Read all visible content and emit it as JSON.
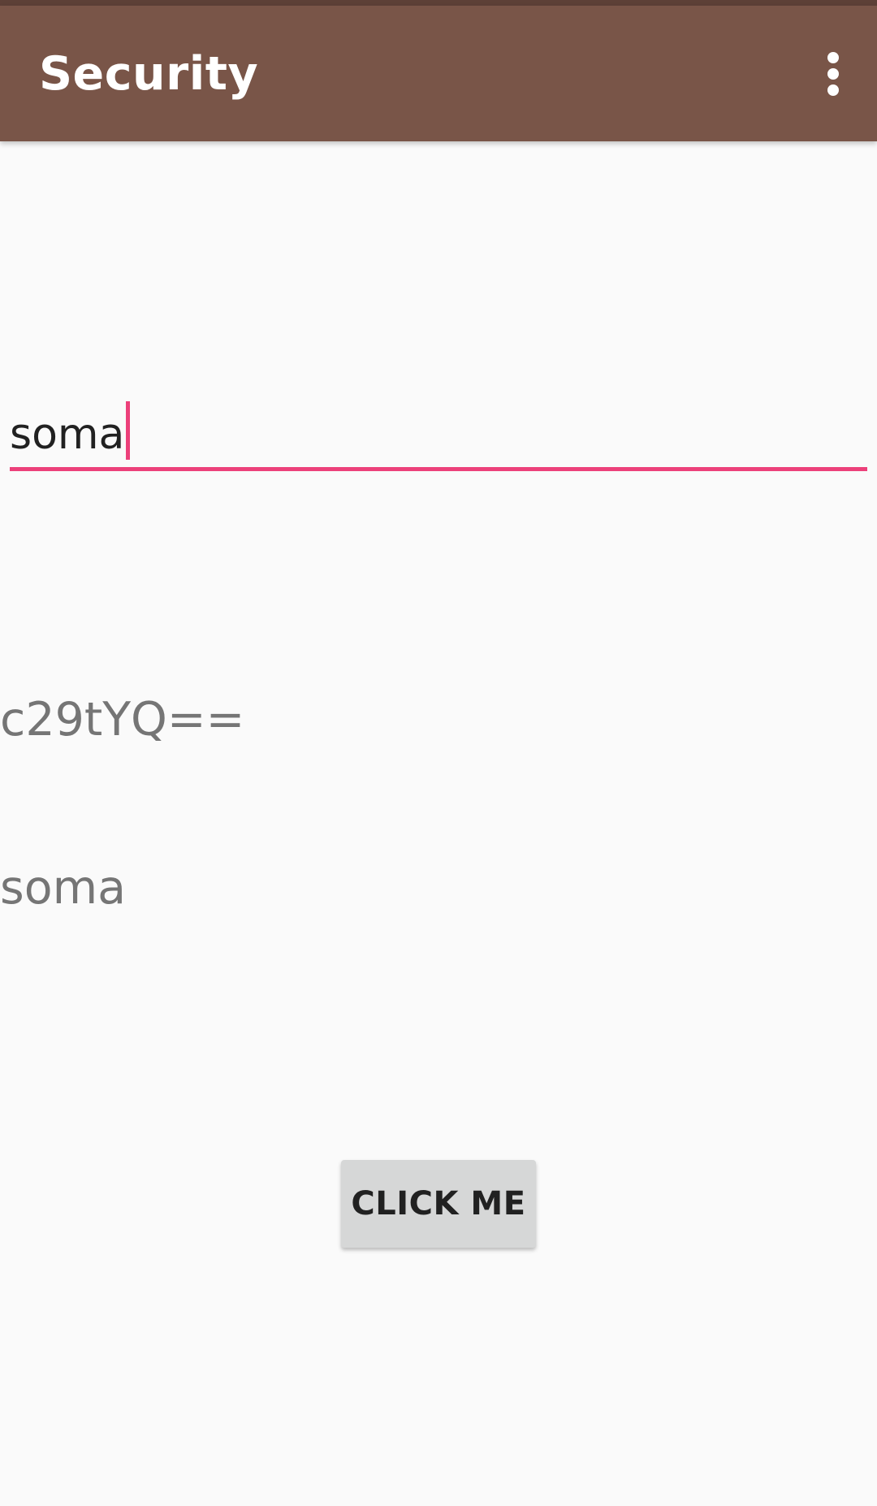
{
  "app_bar": {
    "title": "Security",
    "overflow_icon": "more-vert-icon",
    "background_color": "#795548"
  },
  "input": {
    "value": "soma",
    "accent_color": "#ec407a"
  },
  "outputs": {
    "encoded": "c29tYQ==",
    "decoded": "soma"
  },
  "action_button": {
    "label": "CLICK ME"
  }
}
